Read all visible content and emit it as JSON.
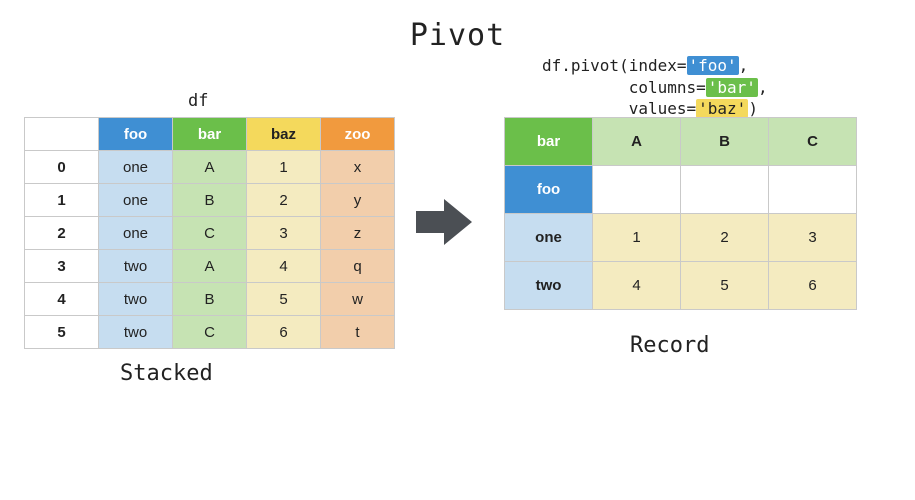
{
  "title": "Pivot",
  "left": {
    "name": "df",
    "caption": "Stacked",
    "columns": [
      "foo",
      "bar",
      "baz",
      "zoo"
    ],
    "column_colors": [
      "blue",
      "green",
      "yellow",
      "orange"
    ],
    "index": [
      "0",
      "1",
      "2",
      "3",
      "4",
      "5"
    ],
    "rows": [
      [
        "one",
        "A",
        "1",
        "x"
      ],
      [
        "one",
        "B",
        "2",
        "y"
      ],
      [
        "one",
        "C",
        "3",
        "z"
      ],
      [
        "two",
        "A",
        "4",
        "q"
      ],
      [
        "two",
        "B",
        "5",
        "w"
      ],
      [
        "two",
        "C",
        "6",
        "t"
      ]
    ]
  },
  "code": {
    "prefix": "df.pivot(",
    "param_index_key": "index=",
    "param_index_val": "'foo'",
    "param_columns_key": "columns=",
    "param_columns_val": "'bar'",
    "param_values_key": "values=",
    "param_values_val": "'baz'",
    "sep": ",",
    "close": ")",
    "indent": "         "
  },
  "right": {
    "caption": "Record",
    "col_index_name": "bar",
    "row_index_name": "foo",
    "columns": [
      "A",
      "B",
      "C"
    ],
    "index": [
      "one",
      "two"
    ],
    "rows": [
      [
        "1",
        "2",
        "3"
      ],
      [
        "4",
        "5",
        "6"
      ]
    ]
  },
  "colors": {
    "blue": "#3f8fd3",
    "green": "#6bbf4a",
    "yellow": "#f4d95c",
    "orange": "#f19a3e",
    "arrow": "#4b4f54"
  }
}
